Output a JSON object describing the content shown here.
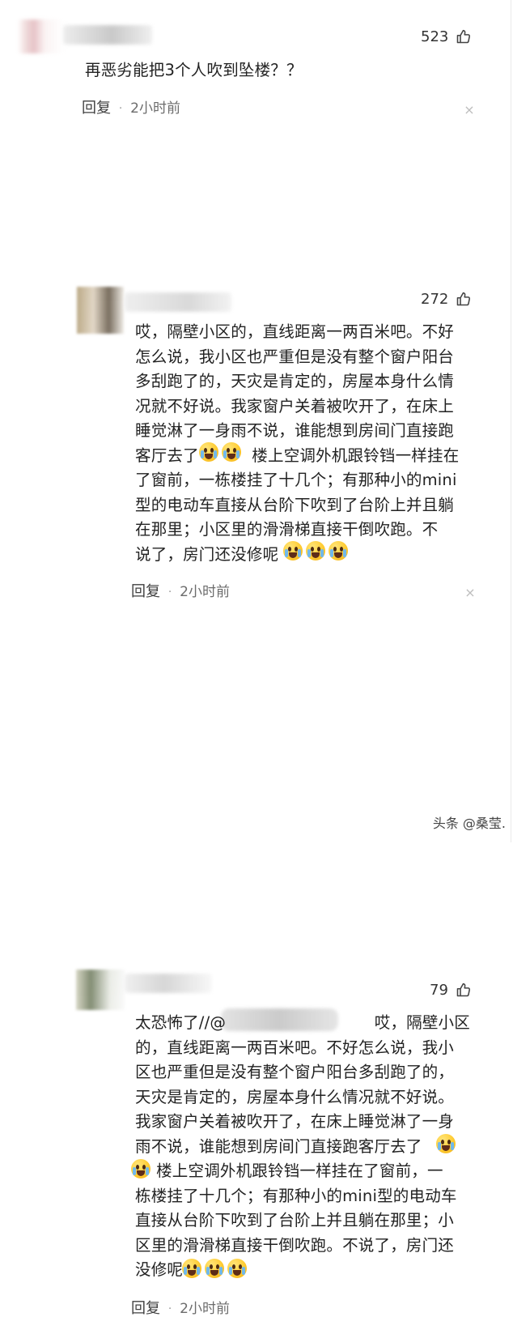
{
  "comments": [
    {
      "likes": "523",
      "text": "再恶劣能把3个人吹到坠楼？？",
      "reply_label": "回复",
      "time": "2小时前"
    },
    {
      "likes": "272",
      "text": "哎，隔壁小区的，直线距离一两百米吧。不好\n怎么说，我小区也严重但是没有整个窗户阳台\n多刮跑了的，天灾是肯定的，房屋本身什么情\n况就不好说。我家窗户关着被吹开了，在床上\n睡觉淋了一身雨不说，谁能想到房间门直接跑\n客厅去了    楼上空调外机跟铃铛一样挂在\n了窗前，一栋楼挂了十几个；有那种小的mini\n型的电动车直接从台阶下吹到了台阶上并且躺\n在那里；小区里的滑滑梯直接干倒吹跑。不\n说了，房门还没修呢",
      "reply_label": "回复",
      "time": "2小时前"
    },
    {
      "likes": "79",
      "text": "太恐怖了//@          哎，隔壁小区\n的，直线距离一两百米吧。不好怎么说，我小\n区也严重但是没有整个窗户阳台多刮跑了的，\n天灾是肯定的，房屋本身什么情况就不好说。\n我家窗户关着被吹开了，在床上睡觉淋了一身\n雨不说，谁能想到房间门直接跑客厅去了\n  楼上空调外机跟铃铛一样挂在了窗前，一\n栋楼挂了十几个；有那种小的mini型的电动车\n直接从台阶下吹到了台阶上并且躺在那里；小\n区里的滑滑梯直接干倒吹跑。不说了，房门还\n没修呢",
      "reply_label": "回复",
      "time": "2小时前"
    }
  ],
  "icons": {
    "like": "thumbs-up-icon",
    "close": "close-icon",
    "emoji": "crying-face-icon"
  },
  "watermark": "头条 @桑莹."
}
